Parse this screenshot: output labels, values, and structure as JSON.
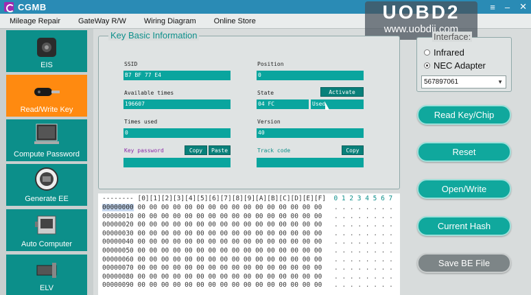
{
  "app": {
    "title": "CGMB",
    "win_buttons": [
      "≡",
      "–",
      "✕"
    ]
  },
  "watermark": {
    "line1": "UOBD2",
    "line2": "www.uobdii.com"
  },
  "menu": [
    "Mileage Repair",
    "GateWay R/W",
    "Wiring Diagram",
    "Online Store"
  ],
  "sidebar": [
    {
      "label": "EIS",
      "icon": "ignition-switch-icon",
      "active": false
    },
    {
      "label": "Read/Write Key",
      "icon": "car-key-icon",
      "active": true
    },
    {
      "label": "Compute Password",
      "icon": "laptop-icon",
      "active": false
    },
    {
      "label": "Generate EE",
      "icon": "chip-icon",
      "active": false
    },
    {
      "label": "Auto Computer",
      "icon": "ecu-module-icon",
      "active": false
    },
    {
      "label": "ELV",
      "icon": "steering-lock-icon",
      "active": false
    }
  ],
  "key_info": {
    "title": "Key Basic Information",
    "ssid": {
      "label": "SSID",
      "value": "B7 BF 77 E4"
    },
    "position": {
      "label": "Position",
      "value": "0"
    },
    "available": {
      "label": "Available times",
      "value": "196607"
    },
    "state": {
      "label": "State",
      "value": "04 FC",
      "extra": "Used",
      "activate": "Activate"
    },
    "times_used": {
      "label": "Times used",
      "value": "0"
    },
    "version": {
      "label": "Version",
      "value": "40"
    },
    "key_password": {
      "label": "Key password",
      "value": "",
      "copy": "Copy",
      "paste": "Paste"
    },
    "track_code": {
      "label": "Track code",
      "value": "",
      "copy": "Copy"
    }
  },
  "interface": {
    "title": "Interface:",
    "options": [
      "Infrared",
      "NEC Adapter"
    ],
    "selected": "NEC Adapter",
    "device": "567897061"
  },
  "actions": [
    "Read Key/Chip",
    "Reset",
    "Open/Write",
    "Current Hash",
    "Save BE File"
  ],
  "hex": {
    "header": "-------- [0][1][2][3][4][5][6][7][8][9][A][B][C][D][E][F]",
    "ascii_header": "0 1 2 3 4 5 6 7",
    "rows": [
      "00000000",
      "00000010",
      "00000020",
      "00000030",
      "00000040",
      "00000050",
      "00000060",
      "00000070",
      "00000080",
      "00000090"
    ],
    "bytes": "00 00 00 00 00 00 00 00 00 00 00 00 00 00 00 00",
    "ascii": ". . . . . . . ."
  }
}
